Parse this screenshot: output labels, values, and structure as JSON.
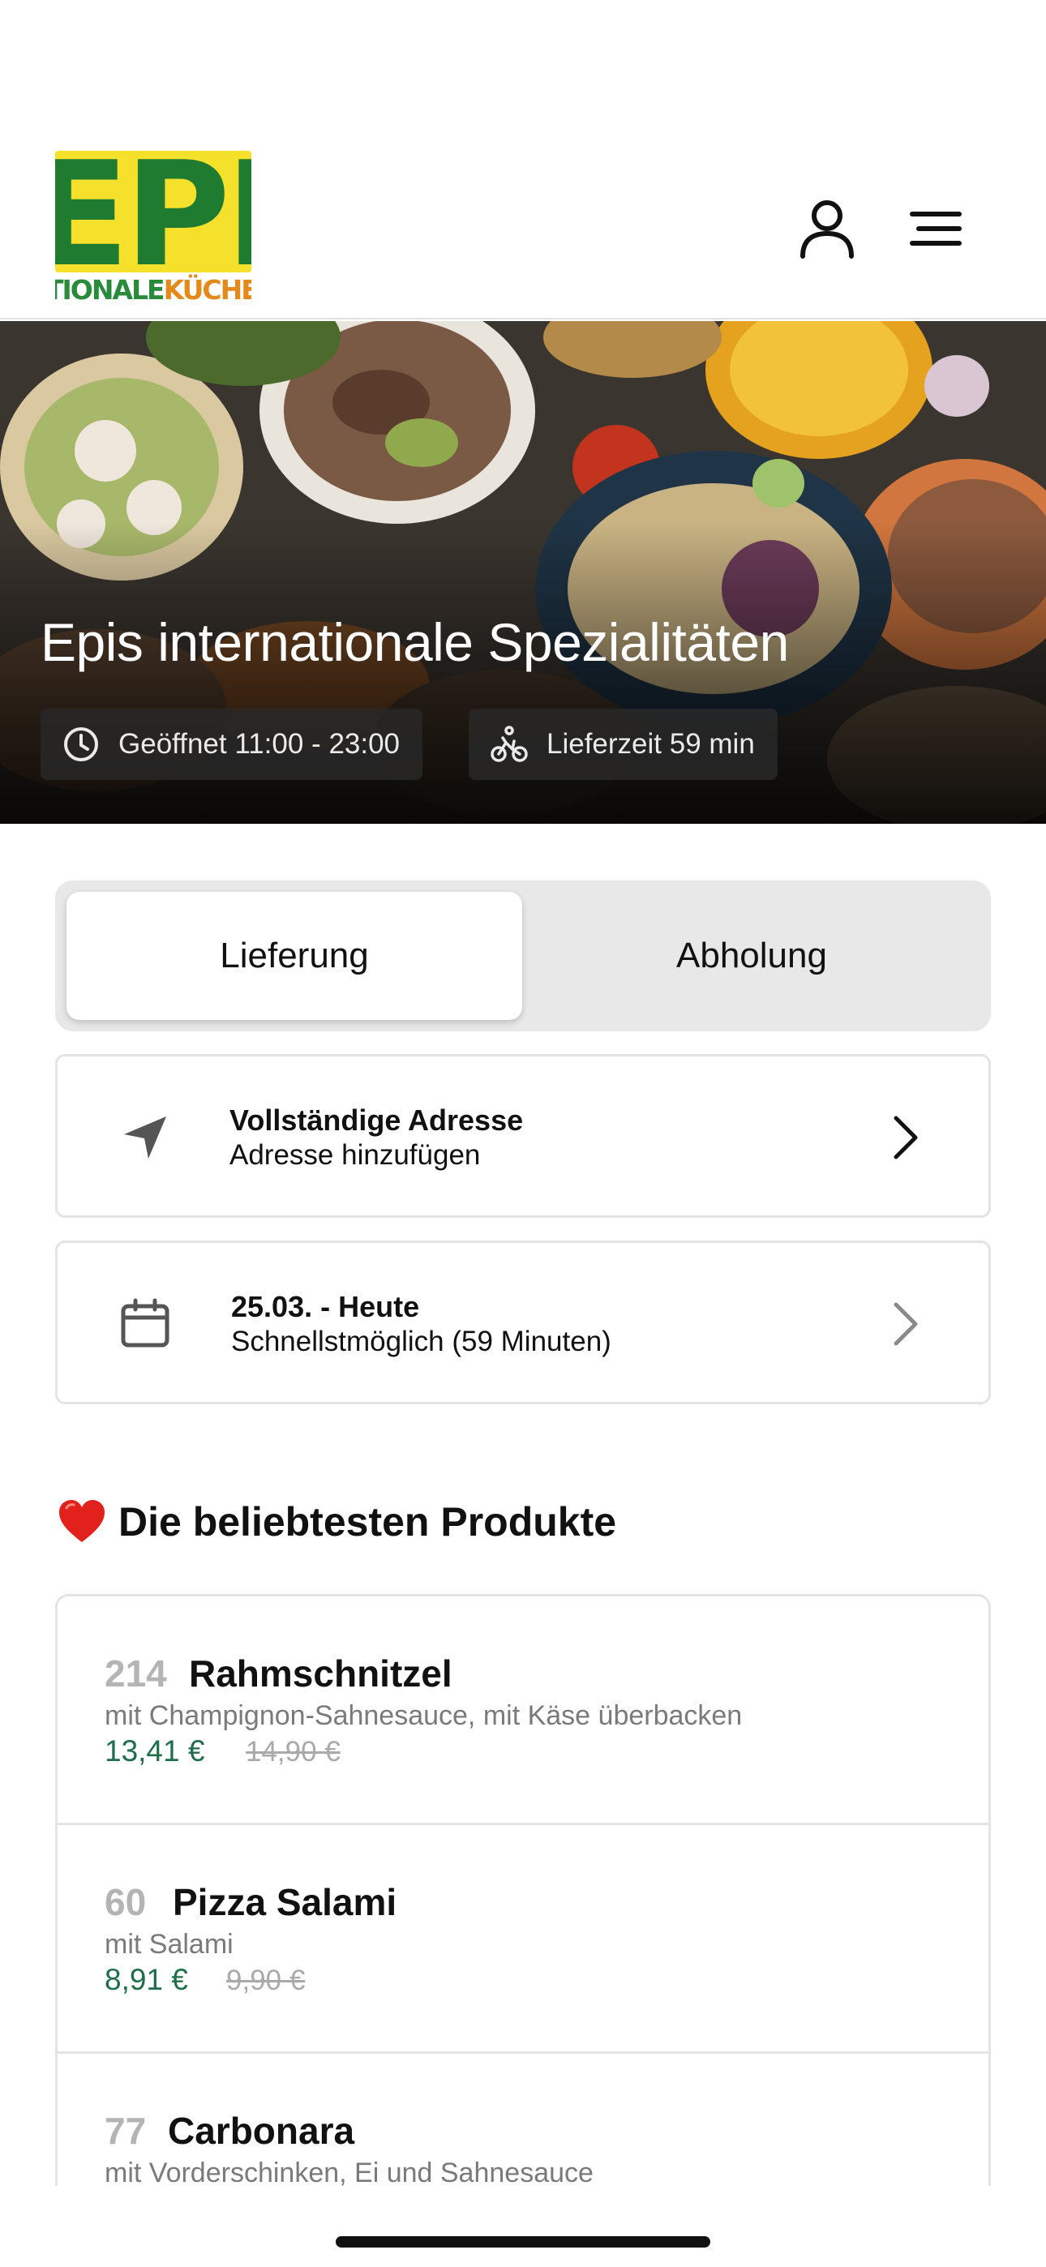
{
  "header": {
    "logo_main": "EPIS",
    "logo_sub_green": "TIONALE",
    "logo_sub_orange": "KÜCHE"
  },
  "hero": {
    "title": "Epis internationale Spezialitäten",
    "opening_hours": "Geöffnet 11:00 - 23:00",
    "delivery_time": "Lieferzeit 59 min"
  },
  "mode_toggle": {
    "options": [
      {
        "label": "Lieferung",
        "active": true
      },
      {
        "label": "Abholung",
        "active": false
      }
    ]
  },
  "address_card": {
    "title": "Vollständige Adresse",
    "subtitle": "Adresse hinzufügen"
  },
  "time_card": {
    "title": "25.03. - Heute",
    "subtitle": "Schnellstmöglich (59 Minuten)"
  },
  "popular": {
    "heading": "Die beliebtesten Produkte",
    "products": [
      {
        "number": "214",
        "name": "Rahmschnitzel",
        "description": "mit Champignon-Sahnesauce, mit Käse überbacken",
        "price": "13,41 €",
        "old_price": "14,90 €"
      },
      {
        "number": "60",
        "name": "Pizza Salami",
        "description": "mit Salami",
        "price": "8,91 €",
        "old_price": "9,90 €"
      },
      {
        "number": "77",
        "name": "Carbonara",
        "description": "mit Vorderschinken, Ei und Sahnesauce",
        "price": "",
        "old_price": ""
      }
    ]
  },
  "colors": {
    "price_green": "#1f6e4a",
    "logo_yellow": "#f5e12b",
    "logo_green": "#1e7b30",
    "toggle_bg": "#e8e8e8"
  },
  "icons": [
    "user-icon",
    "menu-icon",
    "clock-icon",
    "bicycle-icon",
    "location-arrow-icon",
    "calendar-icon",
    "chevron-right-icon",
    "heart-icon"
  ]
}
